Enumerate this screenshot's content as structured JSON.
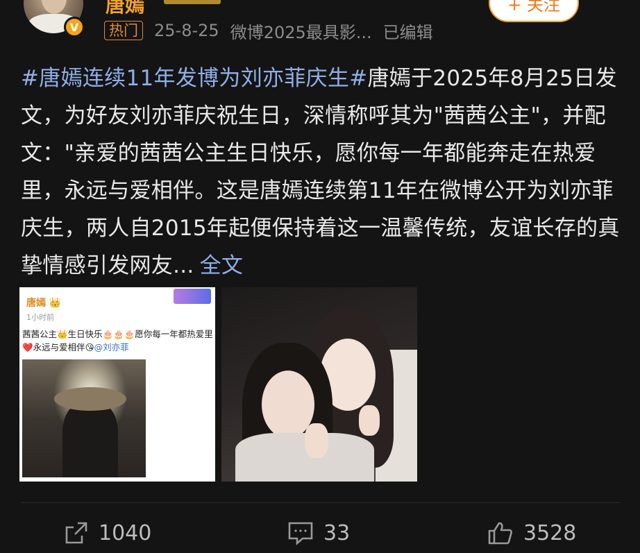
{
  "user": {
    "name": "唐嫣",
    "verified_icon": "v-badge-icon",
    "follow_label": "+ 关注"
  },
  "meta": {
    "hot_badge": "热门",
    "date": "25-8-25",
    "source": "微博2025最具影...",
    "edited": "已编辑"
  },
  "post": {
    "hashtag": "#唐嫣连续11年发博为刘亦菲庆生#",
    "text": "唐嫣于2025年8月25日发文，为好友刘亦菲庆祝生日，深情称呼其为\"茜茜公主\"，并配文：\"亲爱的茜茜公主生日快乐，愿你每一年都能奔走在热爱里，永远与爱相伴。这是唐嫣连续第11年在微博公开为刘亦菲庆生，两人自2015年起便保持着这一温馨传统，友谊长存的真挚情感引发网友...",
    "more_label": "全文"
  },
  "image1": {
    "name": "唐嫣",
    "time": "1小时前",
    "text": "茜茜公主👑生日快乐🎂🎂🎂愿你每一年都热爱里❤️永远与爱相伴😘",
    "mention": "@刘亦菲"
  },
  "actions": {
    "share_count": "1040",
    "comment_count": "33",
    "like_count": "3528"
  },
  "colors": {
    "background": "#141414",
    "hashtag": "#8fb0e8",
    "accent": "#f0a030"
  }
}
